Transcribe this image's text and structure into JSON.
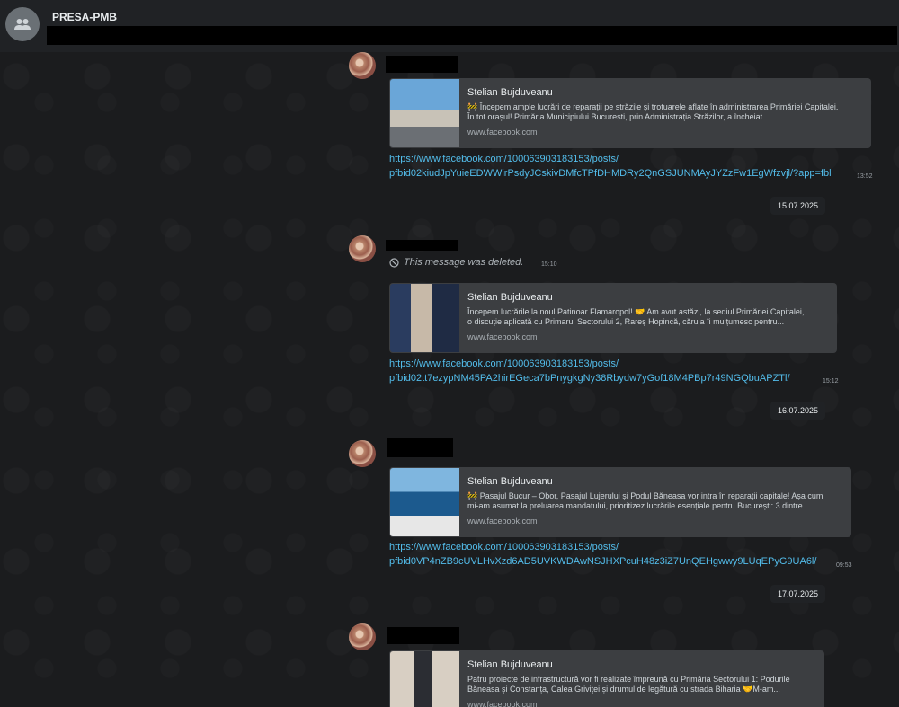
{
  "header": {
    "title": "PRESA-PMB",
    "avatar_icon": "group-icon"
  },
  "messages": [
    {
      "preview": {
        "title": "Stelian Bujduveanu",
        "line1": "🚧 Începem ample lucrări de reparații pe străzile și trotuarele aflate în administrarea Primăriei Capitalei.",
        "line2": "În tot orașul!  Primăria Municipiului București, prin Administrația Străzilor, a încheiat...",
        "domain": "www.facebook.com"
      },
      "link_line1": "https://www.facebook.com/100063903183153/posts/",
      "link_line2": "pfbid02kiudJpYuieEDWWirPsdyJCskivDMfcTPfDHMDRy2QnGSJUNMAyJYZzFw1EgWfzvjl/?app=fbl",
      "time": "13:52"
    },
    {
      "deleted_text": "This message was deleted.",
      "deleted_time": "15:10",
      "preview": {
        "title": "Stelian Bujduveanu",
        "line1": "Începem lucrările la noul Patinoar Flamaropol!  🤝 Am avut astăzi, la sediul Primăriei Capitalei,",
        "line2": "o discuție aplicată cu Primarul Sectorului 2, Rareș Hopincă, căruia îi mulțumesc pentru...",
        "domain": "www.facebook.com"
      },
      "link_line1": "https://www.facebook.com/100063903183153/posts/",
      "link_line2": "pfbid02tt7ezypNM45PA2hirEGeca7bPnygkgNy38Rbydw7yGof18M4PBp7r49NGQbuAPZTl/",
      "time": "15:12"
    },
    {
      "preview": {
        "title": "Stelian Bujduveanu",
        "line1": "🚧 Pasajul Bucur – Obor, Pasajul Lujerului și Podul Băneasa vor intra în reparații capitale!  Așa cum",
        "line2": "mi-am asumat la preluarea mandatului, prioritizez lucrările esențiale pentru București: 3 dintre...",
        "domain": "www.facebook.com"
      },
      "link_line1": "https://www.facebook.com/100063903183153/posts/",
      "link_line2": "pfbid0VP4nZB9cUVLHvXzd6AD5UVKWDAwNSJHXPcuH48z3iZ7UnQEHgwwy9LUqEPyG9UA6l/",
      "time": "09:53"
    },
    {
      "preview": {
        "title": "Stelian Bujduveanu",
        "line1": "Patru proiecte de infrastructură vor fi realizate împreună cu Primăria Sectorului 1: Podurile",
        "line2": "Băneasa și Constanța, Calea Griviței și drumul de legătură cu strada Biharia  🤝M-am...",
        "domain": "www.facebook.com"
      }
    }
  ],
  "dates": [
    "15.07.2025",
    "16.07.2025",
    "17.07.2025"
  ]
}
